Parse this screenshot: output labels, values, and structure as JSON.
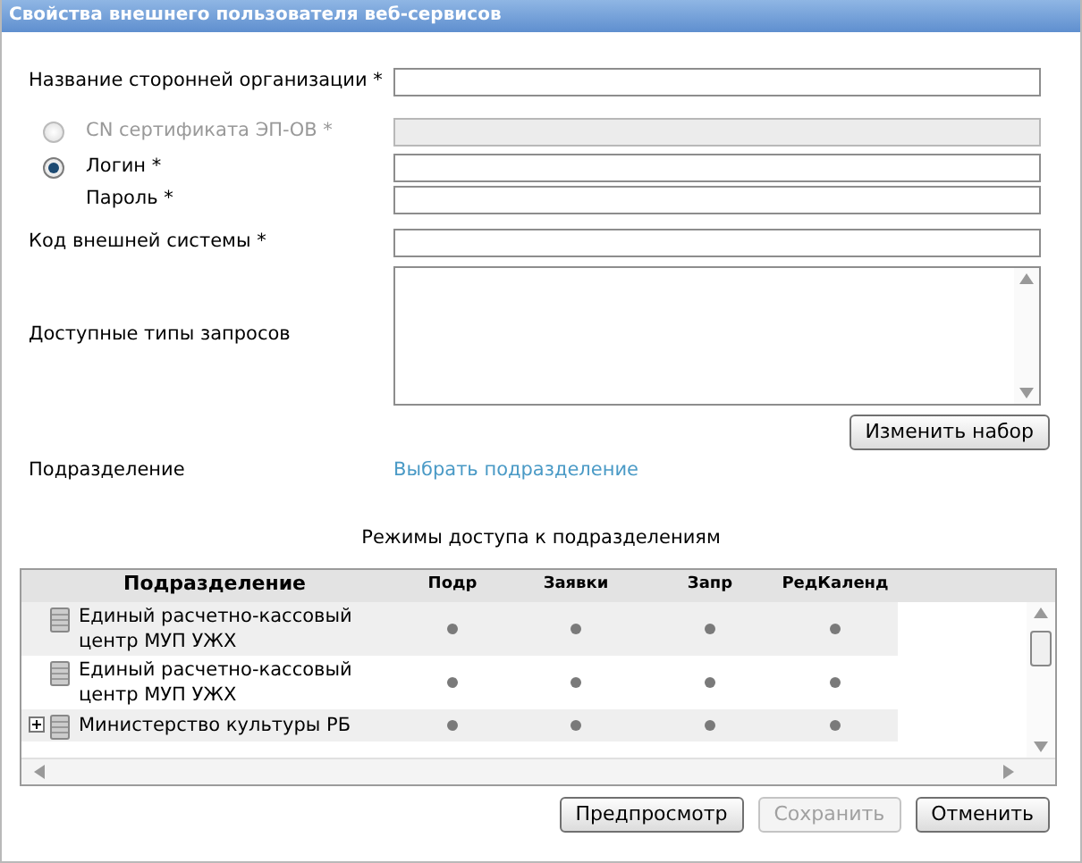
{
  "window": {
    "title": "Свойства внешнего пользователя веб-сервисов"
  },
  "fields": [
    {
      "kind": "text",
      "label": "Название сторонней организации *"
    },
    {
      "kind": "radio",
      "label": "CN сертификата ЭП-ОВ *",
      "selected": false,
      "disabled": true
    },
    {
      "kind": "radio",
      "label": "Логин *",
      "selected": true,
      "disabled": false
    },
    {
      "kind": "text-indented",
      "label": "Пароль *"
    },
    {
      "kind": "text",
      "label": "Код внешней системы *"
    },
    {
      "kind": "textarea",
      "label": "Доступные типы запросов"
    }
  ],
  "change_set_button": "Изменить набор",
  "division": {
    "label": "Подразделение",
    "link": "Выбрать подразделение"
  },
  "access_modes": {
    "title": "Режимы доступа к подразделениям",
    "columns": [
      "Подразделение",
      "Подр",
      "Заявки",
      "Запр",
      "РедКаленд"
    ],
    "rows": [
      {
        "name": "Единый расчетно-кассовый центр МУП УЖХ",
        "expandable": false,
        "access": [
          true,
          true,
          true,
          true
        ]
      },
      {
        "name": "Единый расчетно-кассовый центр МУП УЖХ",
        "expandable": false,
        "access": [
          true,
          true,
          true,
          true
        ]
      },
      {
        "name": "Министерство культуры РБ",
        "expandable": true,
        "access": [
          true,
          true,
          true,
          true
        ]
      }
    ]
  },
  "buttons": [
    {
      "label": "Предпросмотр",
      "disabled": false
    },
    {
      "label": "Сохранить",
      "disabled": true
    },
    {
      "label": "Отменить",
      "disabled": false
    }
  ]
}
